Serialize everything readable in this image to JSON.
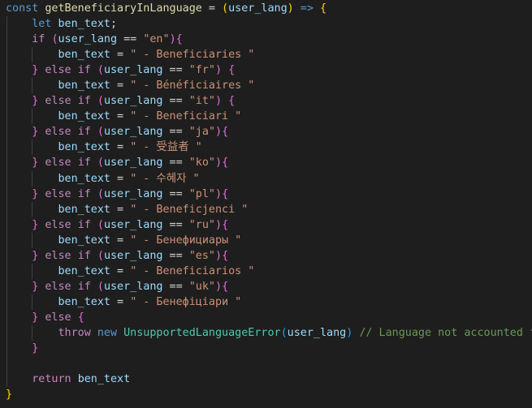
{
  "tokens": {
    "const": "const",
    "fn_name": "getBeneficiaryInLanguage",
    "assign": " = ",
    "param": "user_lang",
    "arrow": " => ",
    "let": "let",
    "ben_text": "ben_text",
    "semicolon": ";",
    "if": "if",
    "else": "else",
    "eq": " == ",
    "eq_assign": " = ",
    "throw": "throw",
    "new": "new",
    "error_class": "UnsupportedLanguageError",
    "comment": "// Language not accounted for",
    "return": "return"
  },
  "branches": [
    {
      "lang": "\"en\"",
      "text": "\" - Beneficiaries \""
    },
    {
      "lang": "\"fr\"",
      "text": "\" - Bénéficiaires \""
    },
    {
      "lang": "\"it\"",
      "text": "\" - Beneficiari \""
    },
    {
      "lang": "\"ja\"",
      "text": "\" - 受益者 \""
    },
    {
      "lang": "\"ko\"",
      "text": "\" - 수혜자 \""
    },
    {
      "lang": "\"pl\"",
      "text": "\" - Beneficjenci \""
    },
    {
      "lang": "\"ru\"",
      "text": "\" - Бенефициары \""
    },
    {
      "lang": "\"es\"",
      "text": "\" - Beneficiarios \""
    },
    {
      "lang": "\"uk\"",
      "text": "\" - Бенефіціари \""
    }
  ],
  "colors": {
    "background": "#1e1e1e",
    "keyword": "#569cd6",
    "control": "#c586c0",
    "function": "#dcdcaa",
    "variable": "#9cdcfe",
    "string": "#ce9178",
    "class": "#4ec9b0",
    "comment": "#6a9955"
  }
}
